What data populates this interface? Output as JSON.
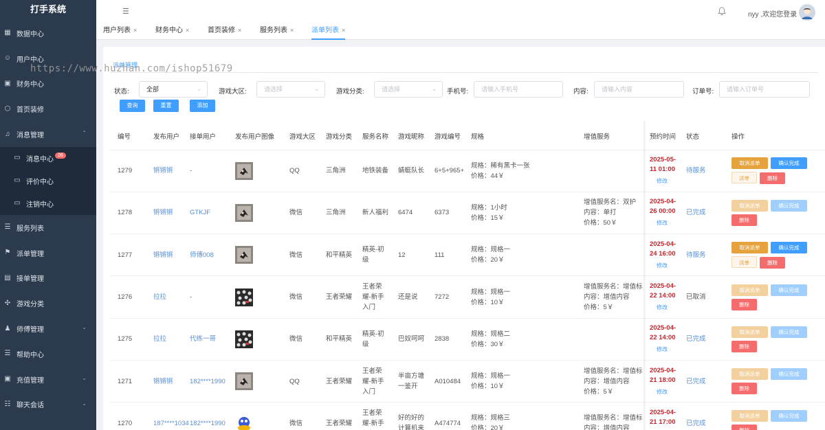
{
  "app": {
    "title": "打手系统"
  },
  "sidebar": {
    "items": [
      {
        "label": "数据中心",
        "icon": "dashboard-icon"
      },
      {
        "label": "用户中心",
        "icon": "user-icon"
      },
      {
        "label": "财务中心",
        "icon": "wallet-icon"
      },
      {
        "label": "首页装修",
        "icon": "box-icon"
      },
      {
        "label": "消息管理",
        "icon": "bell-icon",
        "expanded": true
      }
    ],
    "submenu": [
      {
        "label": "消息中心",
        "badge": "26"
      },
      {
        "label": "评价中心"
      },
      {
        "label": "注销中心"
      }
    ],
    "items2": [
      {
        "label": "服务列表"
      },
      {
        "label": "派单管理"
      },
      {
        "label": "接单管理"
      },
      {
        "label": "游戏分类"
      },
      {
        "label": "师傅管理"
      },
      {
        "label": "帮助中心"
      },
      {
        "label": "充值管理"
      },
      {
        "label": "聊天会话"
      }
    ]
  },
  "header": {
    "user_text": "nyy ,欢迎您登录"
  },
  "tabs": [
    "用户列表",
    "财务中心",
    "首页装修",
    "服务列表",
    "派单列表"
  ],
  "active_tab": "派单列表",
  "breadcrumb": "派单管理",
  "watermark": "https://www.huzhan.com/ishop51679",
  "filters": {
    "status_label": "状态:",
    "status_value": "全部",
    "region_label": "游戏大区:",
    "region_placeholder": "请选择",
    "category_label": "游戏分类:",
    "category_placeholder": "请选择",
    "phone_label": "手机号:",
    "phone_placeholder": "请输入手机号",
    "content_label": "内容:",
    "content_placeholder": "请输入内容",
    "order_label": "订单号:",
    "order_placeholder": "请输入订单号",
    "query_btn": "查询",
    "reset_btn": "重置",
    "add_btn": "添加"
  },
  "table": {
    "headers": [
      "编号",
      "发布用户",
      "接单用户",
      "发布用户图像",
      "游戏大区",
      "游戏分类",
      "服务名称",
      "游戏昵称",
      "游戏编号",
      "规格",
      "增值服务",
      "预约时间",
      "状态",
      "操作"
    ],
    "rows": [
      {
        "id": "1279",
        "publisher": "锵锵锵",
        "taker": "-",
        "img": "cat",
        "region": "QQ",
        "category": "三角洲",
        "service": "地铁装备",
        "nickname": "蜻蜓队长",
        "game_no": "6+5+965+",
        "spec": "规格：稀有黑卡一张\n价格：44￥",
        "extra": "",
        "time": "2025-05-11 01:00",
        "edit": "修改",
        "status": "待服务",
        "status_kind": "link",
        "ops": "active"
      },
      {
        "id": "1278",
        "publisher": "锵锵锵",
        "taker": "GTKJF",
        "img": "cat",
        "region": "微信",
        "category": "三角洲",
        "service": "新人福利",
        "nickname": "6474",
        "game_no": "6373",
        "spec": "规格：1小时\n价格：15￥",
        "extra": "增值服务名：双护\n内容：单打\n价格：50￥",
        "time": "2025-04-26 00:00",
        "edit": "修改",
        "status": "已完成",
        "status_kind": "link",
        "ops": "done"
      },
      {
        "id": "1277",
        "publisher": "锵锵锵",
        "taker": "师傅008",
        "img": "cat",
        "region": "微信",
        "category": "和平精英",
        "service": "精英-初级",
        "nickname": "12",
        "game_no": "111",
        "spec": "规格：规格一\n价格：20￥",
        "extra": "",
        "time": "2025-04-24 16:00",
        "edit": "修改",
        "status": "待服务",
        "status_kind": "link",
        "ops": "active"
      },
      {
        "id": "1276",
        "publisher": "拉拉",
        "taker": "-",
        "img": "pattern",
        "region": "微信",
        "category": "王者荣耀",
        "service": "王者荣耀-新手入门",
        "nickname": "还是说",
        "game_no": "7272",
        "spec": "规格：规格一\n价格：10￥",
        "extra": "增值服务名：增值标题\n内容：增值内容\n价格：5￥",
        "time": "2025-04-22 14:00",
        "edit": "修改",
        "status": "已取消",
        "status_kind": "plain",
        "ops": "done"
      },
      {
        "id": "1275",
        "publisher": "拉拉",
        "taker": "代练一哥",
        "img": "pattern",
        "region": "微信",
        "category": "和平精英",
        "service": "精英-初级",
        "nickname": "巴奴呵呵",
        "game_no": "2838",
        "spec": "规格：规格二\n价格：30￥",
        "extra": "",
        "time": "2025-04-22 14:00",
        "edit": "修改",
        "status": "已完成",
        "status_kind": "link",
        "ops": "done"
      },
      {
        "id": "1271",
        "publisher": "锵锵锵",
        "taker": "182****1990",
        "img": "cat",
        "region": "QQ",
        "category": "王者荣耀",
        "service": "王者荣耀-新手入门",
        "nickname": "半亩方塘一鉴开",
        "game_no": "A010484",
        "spec": "规格：规格一\n价格：10￥",
        "extra": "增值服务名：增值标题\n内容：增值内容\n价格：5￥",
        "time": "2025-04-21 18:00",
        "edit": "修改",
        "status": "已完成",
        "status_kind": "link",
        "ops": "done"
      },
      {
        "id": "1270",
        "publisher": "187****1034",
        "taker": "182****1990",
        "img": "duck",
        "region": "微信",
        "category": "王者荣耀",
        "service": "王者荣耀-新手入门",
        "nickname": "好的好的计算机来",
        "game_no": "A474774",
        "spec": "规格：规格三\n价格：20￥",
        "extra": "增值服务名：增值标题\n内容：增值内容",
        "time": "2025-04-21 17:00",
        "edit": "修改",
        "status": "已完成",
        "status_kind": "link",
        "ops": "done"
      }
    ],
    "op_labels": {
      "cancel": "取消派单",
      "confirm": "确认完成",
      "dispatch": "派单",
      "delete": "删除"
    }
  }
}
